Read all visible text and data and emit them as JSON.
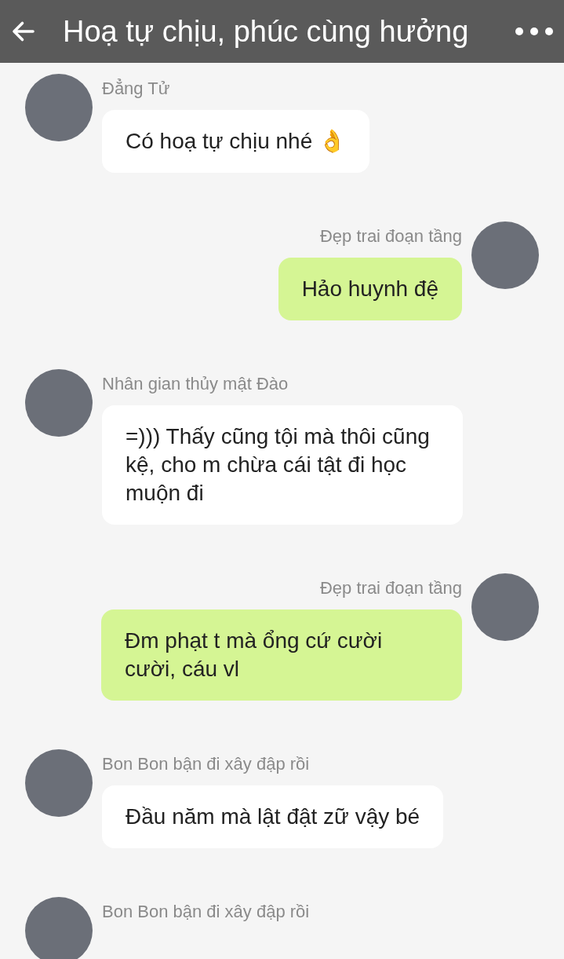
{
  "header": {
    "title": "Hoạ tự chịu, phúc cùng hưởng"
  },
  "messages": [
    {
      "kind": "incoming",
      "sender": "Đẳng Tử",
      "text": "Có hoạ tự chịu nhé 👌"
    },
    {
      "kind": "outgoing",
      "sender": "Đẹp trai đoạn tầng",
      "text": "Hảo huynh đệ"
    },
    {
      "kind": "incoming",
      "sender": "Nhân gian thủy mật Đào",
      "text": "=))) Thấy cũng tội mà thôi cũng kệ, cho m chừa cái tật đi học muộn đi"
    },
    {
      "kind": "outgoing",
      "sender": "Đẹp trai đoạn tầng",
      "text": "Đm phạt t mà ổng cứ cười cười, cáu vl"
    },
    {
      "kind": "incoming",
      "sender": "Bon Bon bận đi xây đập rồi",
      "text": "Đầu năm mà lật đật zữ vậy bé"
    },
    {
      "kind": "incoming",
      "sender": "Bon Bon bận đi xây đập rồi"
    }
  ]
}
